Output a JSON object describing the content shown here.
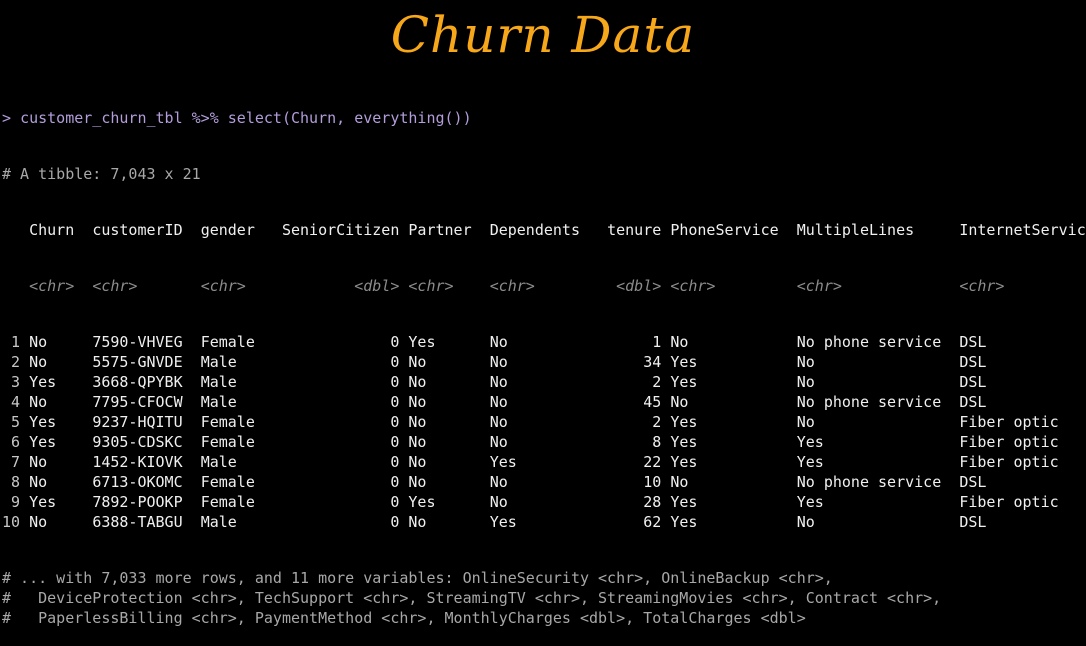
{
  "title": "Churn Data",
  "console": {
    "prompt": ">",
    "command": "customer_churn_tbl %>% select(Churn, everything())",
    "tibble_info": "# A tibble: 7,043 x 21",
    "columns": [
      {
        "name": "Churn",
        "type": "<chr>"
      },
      {
        "name": "customerID",
        "type": "<chr>"
      },
      {
        "name": "gender",
        "type": "<chr>"
      },
      {
        "name": "SeniorCitizen",
        "type": "<dbl>"
      },
      {
        "name": "Partner",
        "type": "<chr>"
      },
      {
        "name": "Dependents",
        "type": "<chr>"
      },
      {
        "name": "tenure",
        "type": "<dbl>"
      },
      {
        "name": "PhoneService",
        "type": "<chr>"
      },
      {
        "name": "MultipleLines",
        "type": "<chr>"
      },
      {
        "name": "InternetService",
        "type": "<chr>"
      }
    ],
    "rows": [
      [
        "1",
        "No",
        "7590-VHVEG",
        "Female",
        "0",
        "Yes",
        "No",
        "1",
        "No",
        "No phone service",
        "DSL"
      ],
      [
        "2",
        "No",
        "5575-GNVDE",
        "Male",
        "0",
        "No",
        "No",
        "34",
        "Yes",
        "No",
        "DSL"
      ],
      [
        "3",
        "Yes",
        "3668-QPYBK",
        "Male",
        "0",
        "No",
        "No",
        "2",
        "Yes",
        "No",
        "DSL"
      ],
      [
        "4",
        "No",
        "7795-CFOCW",
        "Male",
        "0",
        "No",
        "No",
        "45",
        "No",
        "No phone service",
        "DSL"
      ],
      [
        "5",
        "Yes",
        "9237-HQITU",
        "Female",
        "0",
        "No",
        "No",
        "2",
        "Yes",
        "No",
        "Fiber optic"
      ],
      [
        "6",
        "Yes",
        "9305-CDSKC",
        "Female",
        "0",
        "No",
        "No",
        "8",
        "Yes",
        "Yes",
        "Fiber optic"
      ],
      [
        "7",
        "No",
        "1452-KIOVK",
        "Male",
        "0",
        "No",
        "Yes",
        "22",
        "Yes",
        "Yes",
        "Fiber optic"
      ],
      [
        "8",
        "No",
        "6713-OKOMC",
        "Female",
        "0",
        "No",
        "No",
        "10",
        "No",
        "No phone service",
        "DSL"
      ],
      [
        "9",
        "Yes",
        "7892-POOKP",
        "Female",
        "0",
        "Yes",
        "No",
        "28",
        "Yes",
        "Yes",
        "Fiber optic"
      ],
      [
        "10",
        "No",
        "6388-TABGU",
        "Male",
        "0",
        "No",
        "Yes",
        "62",
        "Yes",
        "No",
        "DSL"
      ]
    ],
    "footer": [
      "# ... with 7,033 more rows, and 11 more variables: OnlineSecurity <chr>, OnlineBackup <chr>,",
      "#   DeviceProtection <chr>, TechSupport <chr>, StreamingTV <chr>, StreamingMovies <chr>, Contract <chr>,",
      "#   PaperlessBilling <chr>, PaymentMethod <chr>, MonthlyCharges <dbl>, TotalCharges <dbl>"
    ]
  }
}
